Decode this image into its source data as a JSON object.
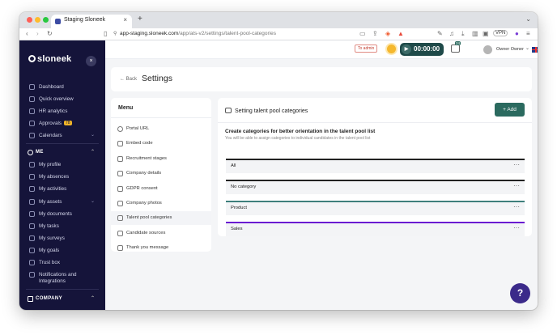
{
  "browser": {
    "tab_title": "Staging Sloneek",
    "tab_close": "×",
    "new_tab": "+",
    "url_host": "app-staging.sloneek.com",
    "url_path": "/app/ats-v2/settings/talent-pool-categories",
    "vpn_label": "VPN",
    "traffic_colors": [
      "#ff5f57",
      "#febc2e",
      "#28c840"
    ]
  },
  "sidebar": {
    "logo": "sloneek",
    "close_label": "×",
    "items": [
      {
        "label": "Dashboard",
        "icon": "home-icon"
      },
      {
        "label": "Quick overview",
        "icon": "grid-icon"
      },
      {
        "label": "HR analytics",
        "icon": "chart-icon"
      },
      {
        "label": "Approvals",
        "icon": "check-icon",
        "badge": "78"
      },
      {
        "label": "Calendars",
        "icon": "calendar-icon",
        "chevron": "⌄"
      }
    ],
    "me_section": {
      "label": "ME",
      "chevron": "⌃"
    },
    "me_items": [
      {
        "label": "My profile",
        "icon": "user-icon"
      },
      {
        "label": "My absences",
        "icon": "absence-icon"
      },
      {
        "label": "My activities",
        "icon": "activity-icon"
      },
      {
        "label": "My assets",
        "icon": "asset-icon",
        "chevron": "⌄"
      },
      {
        "label": "My documents",
        "icon": "folder-icon"
      },
      {
        "label": "My tasks",
        "icon": "task-icon"
      },
      {
        "label": "My surveys",
        "icon": "survey-icon"
      },
      {
        "label": "My goals",
        "icon": "goal-icon"
      },
      {
        "label": "Trust box",
        "icon": "trust-icon"
      },
      {
        "label": "Notifications and Integrations",
        "icon": "gear-icon"
      }
    ],
    "company_section": {
      "label": "COMPANY",
      "chevron": "⌃"
    }
  },
  "topbar": {
    "to_admin": "To admin",
    "timer": "00:00:00",
    "notif_count": "24",
    "user_name": "Owner Owner",
    "user_chevron": "⌄"
  },
  "page": {
    "back_label": "Back",
    "title": "Settings"
  },
  "menu": {
    "title": "Menu",
    "items": [
      {
        "label": "Portal URL",
        "icon": "globe-icon",
        "active": false
      },
      {
        "label": "Embed code",
        "icon": "code-icon",
        "active": false
      },
      {
        "label": "Recruitment stages",
        "icon": "stages-icon",
        "active": false
      },
      {
        "label": "Company details",
        "icon": "company-icon",
        "active": false
      },
      {
        "label": "GDPR consent",
        "icon": "document-icon",
        "active": false
      },
      {
        "label": "Company photos",
        "icon": "photos-icon",
        "active": false
      },
      {
        "label": "Talent pool categories",
        "icon": "category-icon",
        "active": true
      },
      {
        "label": "Candidate sources",
        "icon": "sources-icon",
        "active": false
      },
      {
        "label": "Thank you message",
        "icon": "message-icon",
        "active": false
      }
    ]
  },
  "content": {
    "header": "Setting talent pool categories",
    "add_label": "+ Add",
    "section_title": "Create categories for better orientation in the talent pool list",
    "section_subtitle": "You will be able to assign categories to individual candidates in the talent pool list",
    "more_label": "···",
    "categories": [
      {
        "label": "All",
        "color": "#222222"
      },
      {
        "label": "No category",
        "color": "#222222"
      },
      {
        "label": "Product",
        "color": "#3e7f7c"
      },
      {
        "label": "Sales",
        "color": "#6a1bd1"
      }
    ]
  },
  "help_label": "?"
}
